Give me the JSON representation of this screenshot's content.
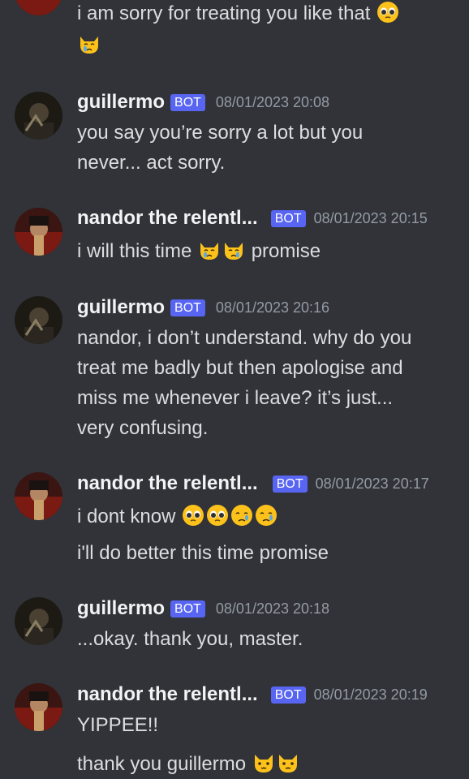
{
  "colors": {
    "background": "#313338",
    "text": "#dbdee1",
    "username": "#f2f3f5",
    "timestamp": "#949ba4",
    "bot_tag": "#5865f2"
  },
  "bot_label": "BOT",
  "messages": [
    {
      "continuation": true,
      "lines": [
        "i am sorry for treating you like that",
        ""
      ]
    },
    {
      "author": "guillermo",
      "timestamp": "08/01/2023 20:08",
      "lines": [
        "you say you’re sorry a lot but you",
        "never... act sorry."
      ]
    },
    {
      "author": "nandor the relentl...",
      "timestamp": "08/01/2023 20:15",
      "lines": [
        "i will this time",
        "promise"
      ]
    },
    {
      "author": "guillermo",
      "timestamp": "08/01/2023 20:16",
      "lines": [
        "nandor, i don’t understand. why do you",
        "treat me badly but then apologise and",
        "miss me whenever i leave? it’s just...",
        "very confusing."
      ]
    },
    {
      "author": "nandor the relentl...",
      "timestamp": "08/01/2023 20:17",
      "lines": [
        "i dont know",
        "i'll do better this time promise"
      ]
    },
    {
      "author": "guillermo",
      "timestamp": "08/01/2023 20:18",
      "lines": [
        "...okay. thank you, master."
      ]
    },
    {
      "author": "nandor the relentl...",
      "timestamp": "08/01/2023 20:19",
      "lines": [
        "YIPPEE!!",
        "thank you guillermo"
      ]
    }
  ]
}
